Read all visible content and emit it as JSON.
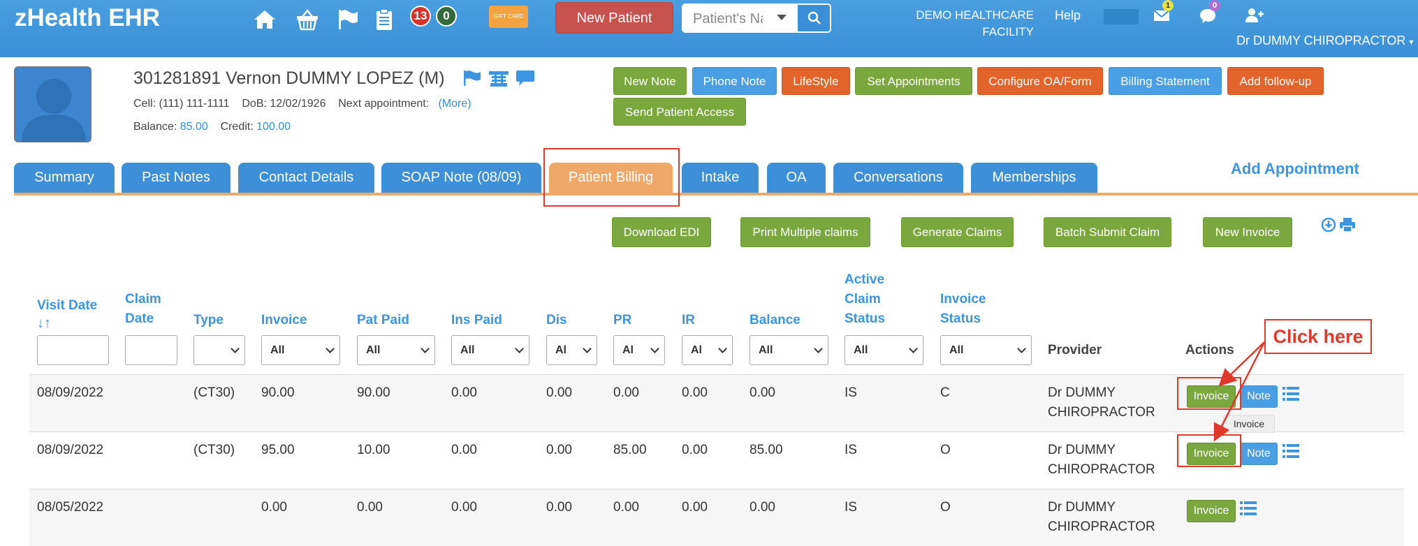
{
  "app": {
    "brand": "zHealth EHR",
    "notifications": {
      "red_count": "13",
      "green_count": "0"
    },
    "gift_card_label": "GIFT CARD",
    "new_patient_label": "New Patient",
    "search_placeholder": "Patient's Name",
    "facility_line1": "DEMO HEALTHCARE",
    "facility_line2": "FACILITY",
    "help_label": "Help",
    "mail_count": "1",
    "chat_count": "0",
    "user_name": "Dr DUMMY CHIROPRACTOR"
  },
  "patient": {
    "title": "301281891 Vernon DUMMY LOPEZ (M)",
    "cell_label": "Cell:",
    "cell_value": "(111) 111-1111",
    "dob_label": "DoB:",
    "dob_value": "12/02/1926",
    "next_appt_label": "Next appointment:",
    "next_appt_link": "(More)",
    "balance_label": "Balance:",
    "balance_value": "85.00",
    "credit_label": "Credit:",
    "credit_value": "100.00"
  },
  "header_buttons": [
    {
      "label": "New Note",
      "color": "#7aa83f"
    },
    {
      "label": "Phone Note",
      "color": "#4a9ee3"
    },
    {
      "label": "LifeStyle",
      "color": "#e2642a"
    },
    {
      "label": "Set Appointments",
      "color": "#7aa83f"
    },
    {
      "label": "Configure OA/Form",
      "color": "#e2642a"
    },
    {
      "label": "Billing Statement",
      "color": "#4a9ee3"
    },
    {
      "label": "Add follow-up",
      "color": "#e2642a"
    },
    {
      "label": "Send Patient Access",
      "color": "#7aa83f"
    }
  ],
  "tabs": [
    {
      "label": "Summary"
    },
    {
      "label": "Past Notes"
    },
    {
      "label": "Contact Details"
    },
    {
      "label": "SOAP Note (08/09)"
    },
    {
      "label": "Patient Billing",
      "active": true
    },
    {
      "label": "Intake"
    },
    {
      "label": "OA"
    },
    {
      "label": "Conversations"
    },
    {
      "label": "Memberships"
    }
  ],
  "add_appointment": "Add Appointment",
  "billing_actions": [
    "Download EDI",
    "Print Multiple claims",
    "Generate Claims",
    "Batch Submit Claim",
    "New Invoice"
  ],
  "table": {
    "headers": {
      "visit_date": "Visit Date",
      "claim_date_1": "Claim",
      "claim_date_2": "Date",
      "type": "Type",
      "invoice": "Invoice",
      "pat_paid": "Pat Paid",
      "ins_paid": "Ins Paid",
      "dis": "Dis",
      "pr": "PR",
      "ir": "IR",
      "balance": "Balance",
      "active_claim_status_1": "Active",
      "active_claim_status_2": "Claim",
      "active_claim_status_3": "Status",
      "invoice_status_1": "Invoice",
      "invoice_status_2": "Status",
      "provider": "Provider",
      "actions": "Actions"
    },
    "filters": {
      "all": "All",
      "all_truncated": "Al"
    },
    "rows": [
      {
        "visit_date": "08/09/2022",
        "claim_date": "",
        "type": "(CT30)",
        "invoice": "90.00",
        "pat_paid": "90.00",
        "ins_paid": "0.00",
        "dis": "0.00",
        "pr": "0.00",
        "ir": "0.00",
        "balance": "0.00",
        "active_claim_status": "IS",
        "invoice_status": "C",
        "provider_1": "Dr DUMMY",
        "provider_2": "CHIROPRACTOR",
        "invoice_btn": "Invoice",
        "note_btn": "Note"
      },
      {
        "visit_date": "08/09/2022",
        "claim_date": "",
        "type": "(CT30)",
        "invoice": "95.00",
        "pat_paid": "10.00",
        "ins_paid": "0.00",
        "dis": "0.00",
        "pr": "85.00",
        "ir": "0.00",
        "balance": "85.00",
        "active_claim_status": "IS",
        "invoice_status": "O",
        "provider_1": "Dr DUMMY",
        "provider_2": "CHIROPRACTOR",
        "invoice_btn": "Invoice",
        "note_btn": "Note"
      },
      {
        "visit_date": "08/05/2022",
        "claim_date": "",
        "type": "",
        "invoice": "0.00",
        "pat_paid": "0.00",
        "ins_paid": "0.00",
        "dis": "0.00",
        "pr": "0.00",
        "ir": "0.00",
        "balance": "0.00",
        "active_claim_status": "IS",
        "invoice_status": "O",
        "provider_1": "Dr DUMMY",
        "provider_2": "CHIROPRACTOR",
        "invoice_btn": "Invoice",
        "note_btn": ""
      }
    ]
  },
  "annotation": {
    "callout": "Click here",
    "tooltip": "Invoice",
    "color": "#e0392b"
  }
}
